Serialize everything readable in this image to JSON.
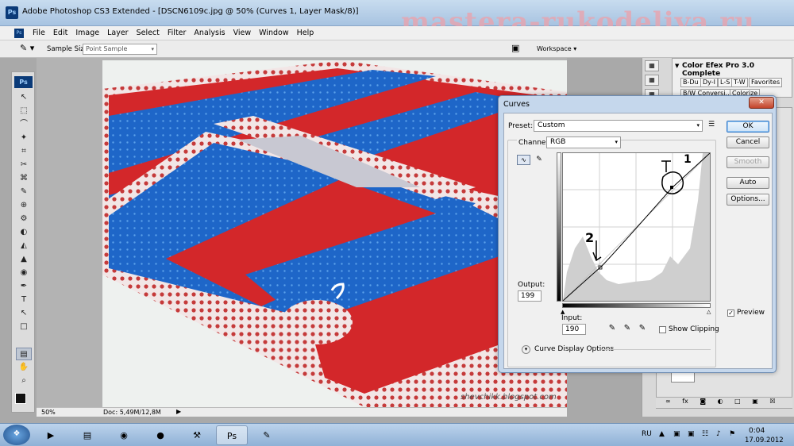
{
  "window": {
    "title": "Adobe Photoshop CS3 Extended - [DSCN6109c.jpg @ 50% (Curves 1, Layer Mask/8)]",
    "app_icon": "Ps",
    "watermark": "mastera-rukodeliya.ru"
  },
  "menu": [
    "File",
    "Edit",
    "Image",
    "Layer",
    "Select",
    "Filter",
    "Analysis",
    "View",
    "Window",
    "Help"
  ],
  "options_bar": {
    "sample_size_label": "Sample Size:",
    "sample_size_value": "Point Sample",
    "workspace_label": "Workspace ▾"
  },
  "toolbox": {
    "logo": "Ps",
    "tools": [
      "↖",
      "⬚",
      "⌒",
      "✦",
      "⌗",
      "✂",
      "⌘",
      "✎",
      "⊕",
      "⚙",
      "◐",
      "◭",
      "▲",
      "◉",
      "✒",
      "T",
      "↖",
      "□",
      "▤",
      "✋",
      "⌕"
    ]
  },
  "canvas": {
    "blog_watermark": "shevchikk.blogspot.com"
  },
  "status": {
    "zoom": "50%",
    "doc": "Doc: 5,49M/12,8M"
  },
  "fx_panel": {
    "title": "Color Efex Pro 3.0 Complete",
    "tabs": [
      "B-Du",
      "Dy-I",
      "L-S",
      "T-W",
      "Favorites"
    ],
    "row2": [
      "B/W Conversi...",
      "Colorize"
    ]
  },
  "curves": {
    "title": "Curves",
    "close": "✕",
    "preset_label": "Preset:",
    "preset_value": "Custom",
    "channel_label": "Channel:",
    "channel_value": "RGB",
    "output_label": "Output:",
    "output_value": "199",
    "input_label": "Input:",
    "input_value": "190",
    "show_clipping": "Show Clipping",
    "curve_display_options": "Curve Display Options",
    "buttons": {
      "ok": "OK",
      "cancel": "Cancel",
      "smooth": "Smooth",
      "auto": "Auto",
      "options": "Options..."
    },
    "preview_label": "Preview",
    "preview_checked": true,
    "annotations": [
      "1",
      "2"
    ]
  },
  "taskbar": {
    "lang": "RU",
    "time": "0:04",
    "date": "17.09.2012",
    "apps": [
      "media-player-icon",
      "folder-icon",
      "chrome-icon",
      "firefox-icon",
      "utility-icon",
      "photoshop-icon",
      "paint-icon"
    ]
  }
}
